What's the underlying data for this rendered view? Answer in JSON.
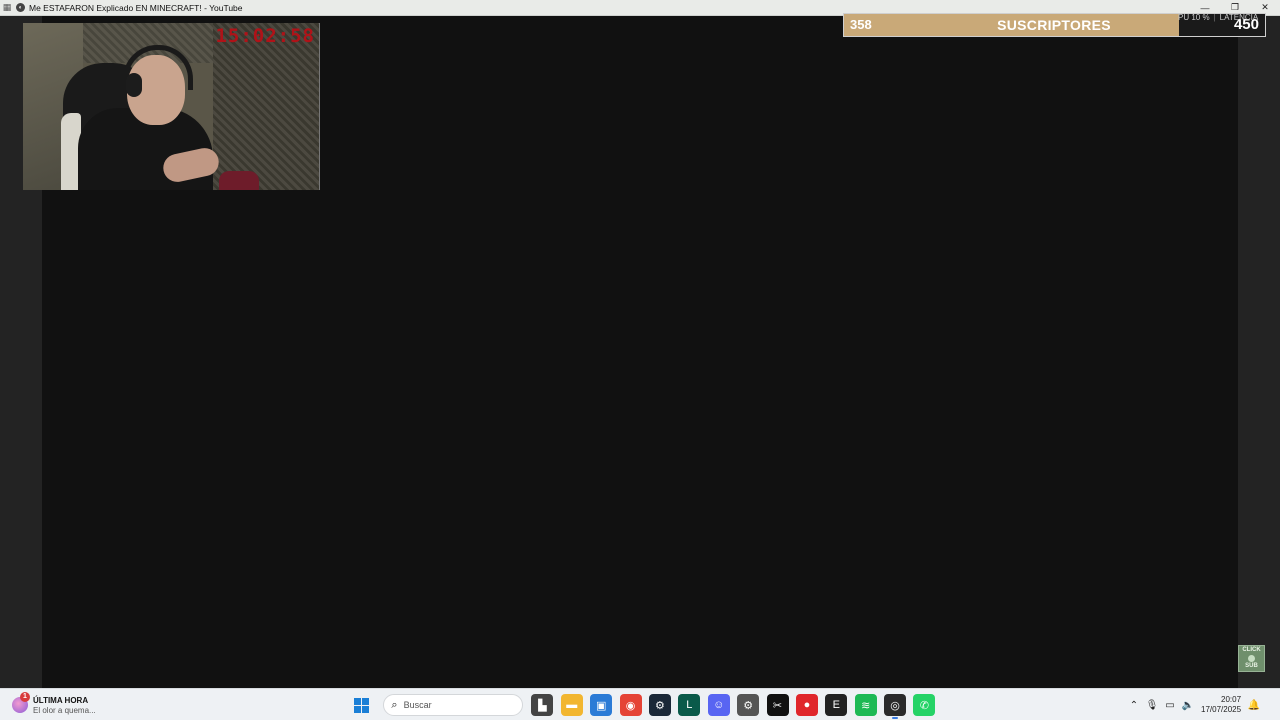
{
  "window": {
    "title": "Me ESTAFARON Explicado EN MINECRAFT! - YouTube",
    "controls": {
      "minimize": "—",
      "maximize": "❐",
      "close": "✕"
    }
  },
  "webcam": {
    "clock_text": "15:02:58"
  },
  "subscriber_goal": {
    "current": "358",
    "label": "SUSCRIPTORES",
    "goal": "450",
    "progress_fraction": 0.7956,
    "fill_color": "#c9a978"
  },
  "perf_overlay": {
    "text_a": "PU 10 %",
    "text_b": "LATENCIA"
  },
  "sub_badge": {
    "line1": "CLICK",
    "line2": "SUB"
  },
  "taskbar": {
    "news_badge": "1",
    "news_title": "ÚLTIMA HORA",
    "news_sub": "El olor a quema...",
    "search_placeholder": "Buscar",
    "pinned": [
      {
        "name": "file-explorer-icon",
        "glyph": "▙",
        "color": "#444444"
      },
      {
        "name": "folder-icon",
        "glyph": "▬",
        "color": "#f2b630"
      },
      {
        "name": "store-icon",
        "glyph": "▣",
        "color": "#2b7bd6"
      },
      {
        "name": "chrome-icon",
        "glyph": "◉",
        "color": "#e54335"
      },
      {
        "name": "steam-icon",
        "glyph": "⚙",
        "color": "#1b2838"
      },
      {
        "name": "league-icon",
        "glyph": "L",
        "color": "#0a5a4a"
      },
      {
        "name": "discord-icon",
        "glyph": "☺",
        "color": "#5865f2"
      },
      {
        "name": "settings-icon",
        "glyph": "⚙",
        "color": "#555555"
      },
      {
        "name": "capcut-icon",
        "glyph": "✂",
        "color": "#111111"
      },
      {
        "name": "app-red-icon",
        "glyph": "●",
        "color": "#e0262b"
      },
      {
        "name": "epic-games-icon",
        "glyph": "E",
        "color": "#222222"
      },
      {
        "name": "spotify-icon",
        "glyph": "≋",
        "color": "#1db954"
      },
      {
        "name": "obs-icon",
        "glyph": "◎",
        "color": "#2b2b2b"
      },
      {
        "name": "whatsapp-icon",
        "glyph": "✆",
        "color": "#25d366"
      }
    ],
    "time": "20:07",
    "date": "17/07/2025"
  }
}
